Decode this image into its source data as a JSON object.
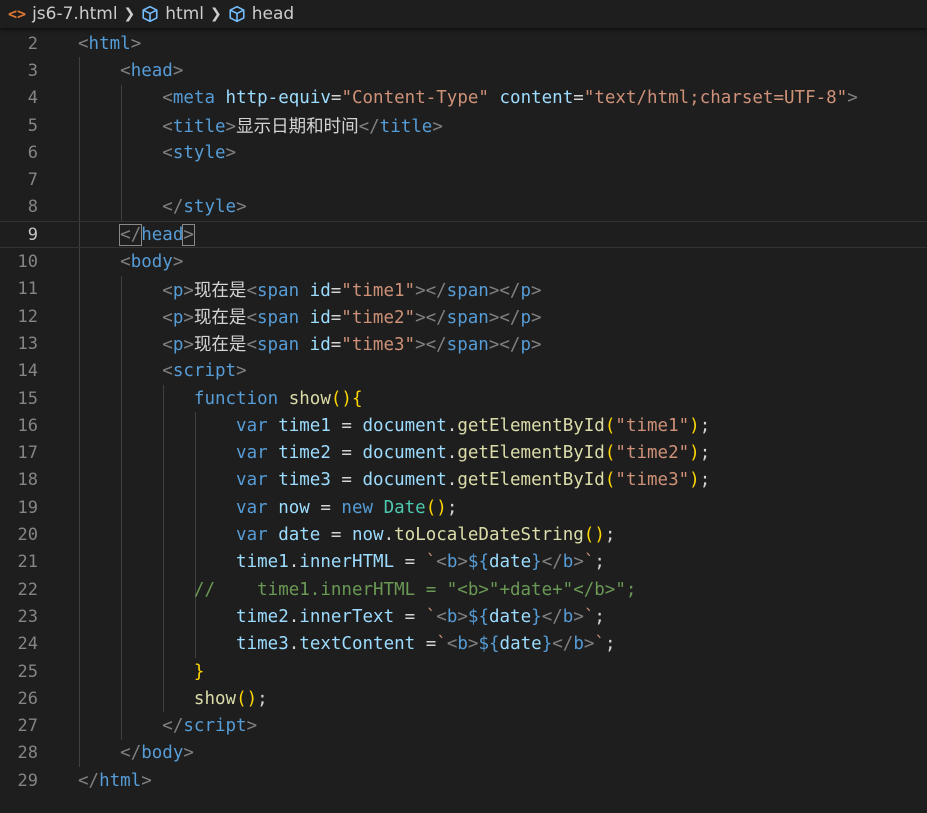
{
  "breadcrumb": {
    "file_icon": "<>",
    "file": "js6-7.html",
    "items": [
      "html",
      "head"
    ]
  },
  "lines": [
    {
      "n": "2",
      "tokens": [
        [
          "p",
          "<"
        ],
        [
          "t",
          "html"
        ],
        [
          "p",
          ">"
        ]
      ]
    },
    {
      "n": "3",
      "tokens": [
        [
          "w",
          "    "
        ],
        [
          "p",
          "<"
        ],
        [
          "t",
          "head"
        ],
        [
          "p",
          ">"
        ]
      ]
    },
    {
      "n": "4",
      "tokens": [
        [
          "w",
          "        "
        ],
        [
          "p",
          "<"
        ],
        [
          "t",
          "meta "
        ],
        [
          "a",
          "http-equiv"
        ],
        [
          "w",
          "="
        ],
        [
          "s",
          "\"Content-Type\""
        ],
        [
          "w",
          " "
        ],
        [
          "a",
          "content"
        ],
        [
          "w",
          "="
        ],
        [
          "s",
          "\"text/html;charset=UTF-8\""
        ],
        [
          "p",
          ">"
        ]
      ]
    },
    {
      "n": "5",
      "tokens": [
        [
          "w",
          "        "
        ],
        [
          "p",
          "<"
        ],
        [
          "t",
          "title"
        ],
        [
          "p",
          ">"
        ],
        [
          "w",
          "显示日期和时间"
        ],
        [
          "p",
          "</"
        ],
        [
          "t",
          "title"
        ],
        [
          "p",
          ">"
        ]
      ]
    },
    {
      "n": "6",
      "tokens": [
        [
          "w",
          "        "
        ],
        [
          "p",
          "<"
        ],
        [
          "t",
          "style"
        ],
        [
          "p",
          ">"
        ]
      ]
    },
    {
      "n": "7",
      "tokens": []
    },
    {
      "n": "8",
      "tokens": [
        [
          "w",
          "        "
        ],
        [
          "p",
          "</"
        ],
        [
          "t",
          "style"
        ],
        [
          "p",
          ">"
        ]
      ]
    },
    {
      "n": "9",
      "tokens": [
        [
          "w",
          "    "
        ],
        [
          "p",
          "</"
        ],
        [
          "t",
          "head"
        ],
        [
          "p",
          ">"
        ]
      ],
      "current": true
    },
    {
      "n": "10",
      "tokens": [
        [
          "w",
          "    "
        ],
        [
          "p",
          "<"
        ],
        [
          "t",
          "body"
        ],
        [
          "p",
          ">"
        ]
      ]
    },
    {
      "n": "11",
      "tokens": [
        [
          "w",
          "        "
        ],
        [
          "p",
          "<"
        ],
        [
          "t",
          "p"
        ],
        [
          "p",
          ">"
        ],
        [
          "w",
          "现在是"
        ],
        [
          "p",
          "<"
        ],
        [
          "t",
          "span "
        ],
        [
          "a",
          "id"
        ],
        [
          "w",
          "="
        ],
        [
          "s",
          "\"time1\""
        ],
        [
          "p",
          "></"
        ],
        [
          "t",
          "span"
        ],
        [
          "p",
          "></"
        ],
        [
          "t",
          "p"
        ],
        [
          "p",
          ">"
        ]
      ]
    },
    {
      "n": "12",
      "tokens": [
        [
          "w",
          "        "
        ],
        [
          "p",
          "<"
        ],
        [
          "t",
          "p"
        ],
        [
          "p",
          ">"
        ],
        [
          "w",
          "现在是"
        ],
        [
          "p",
          "<"
        ],
        [
          "t",
          "span "
        ],
        [
          "a",
          "id"
        ],
        [
          "w",
          "="
        ],
        [
          "s",
          "\"time2\""
        ],
        [
          "p",
          "></"
        ],
        [
          "t",
          "span"
        ],
        [
          "p",
          "></"
        ],
        [
          "t",
          "p"
        ],
        [
          "p",
          ">"
        ]
      ]
    },
    {
      "n": "13",
      "tokens": [
        [
          "w",
          "        "
        ],
        [
          "p",
          "<"
        ],
        [
          "t",
          "p"
        ],
        [
          "p",
          ">"
        ],
        [
          "w",
          "现在是"
        ],
        [
          "p",
          "<"
        ],
        [
          "t",
          "span "
        ],
        [
          "a",
          "id"
        ],
        [
          "w",
          "="
        ],
        [
          "s",
          "\"time3\""
        ],
        [
          "p",
          "></"
        ],
        [
          "t",
          "span"
        ],
        [
          "p",
          "></"
        ],
        [
          "t",
          "p"
        ],
        [
          "p",
          ">"
        ]
      ]
    },
    {
      "n": "14",
      "tokens": [
        [
          "w",
          "        "
        ],
        [
          "p",
          "<"
        ],
        [
          "t",
          "script"
        ],
        [
          "p",
          ">"
        ]
      ]
    },
    {
      "n": "15",
      "tokens": [
        [
          "w",
          "           "
        ],
        [
          "k",
          "function "
        ],
        [
          "f",
          "show"
        ],
        [
          "y",
          "(){"
        ]
      ]
    },
    {
      "n": "16",
      "tokens": [
        [
          "w",
          "               "
        ],
        [
          "k",
          "var "
        ],
        [
          "a",
          "time1"
        ],
        [
          "w",
          " = "
        ],
        [
          "a",
          "document"
        ],
        [
          "w",
          "."
        ],
        [
          "f",
          "getElementById"
        ],
        [
          "y",
          "("
        ],
        [
          "s",
          "\"time1\""
        ],
        [
          "y",
          ")"
        ],
        [
          "w",
          ";"
        ]
      ]
    },
    {
      "n": "17",
      "tokens": [
        [
          "w",
          "               "
        ],
        [
          "k",
          "var "
        ],
        [
          "a",
          "time2"
        ],
        [
          "w",
          " = "
        ],
        [
          "a",
          "document"
        ],
        [
          "w",
          "."
        ],
        [
          "f",
          "getElementById"
        ],
        [
          "y",
          "("
        ],
        [
          "s",
          "\"time2\""
        ],
        [
          "y",
          ")"
        ],
        [
          "w",
          ";"
        ]
      ]
    },
    {
      "n": "18",
      "tokens": [
        [
          "w",
          "               "
        ],
        [
          "k",
          "var "
        ],
        [
          "a",
          "time3"
        ],
        [
          "w",
          " = "
        ],
        [
          "a",
          "document"
        ],
        [
          "w",
          "."
        ],
        [
          "f",
          "getElementById"
        ],
        [
          "y",
          "("
        ],
        [
          "s",
          "\"time3\""
        ],
        [
          "y",
          ")"
        ],
        [
          "w",
          ";"
        ]
      ]
    },
    {
      "n": "19",
      "tokens": [
        [
          "w",
          "               "
        ],
        [
          "k",
          "var "
        ],
        [
          "a",
          "now"
        ],
        [
          "w",
          " = "
        ],
        [
          "k",
          "new "
        ],
        [
          "cls",
          "Date"
        ],
        [
          "y",
          "()"
        ],
        [
          "w",
          ";"
        ]
      ]
    },
    {
      "n": "20",
      "tokens": [
        [
          "w",
          "               "
        ],
        [
          "k",
          "var "
        ],
        [
          "a",
          "date"
        ],
        [
          "w",
          " = "
        ],
        [
          "a",
          "now"
        ],
        [
          "w",
          "."
        ],
        [
          "f",
          "toLocaleDateString"
        ],
        [
          "y",
          "()"
        ],
        [
          "w",
          ";"
        ]
      ]
    },
    {
      "n": "21",
      "tokens": [
        [
          "w",
          "               "
        ],
        [
          "a",
          "time1"
        ],
        [
          "w",
          "."
        ],
        [
          "a",
          "innerHTML"
        ],
        [
          "w",
          " = "
        ],
        [
          "s",
          "`"
        ],
        [
          "p",
          "<"
        ],
        [
          "t",
          "b"
        ],
        [
          "p",
          ">"
        ],
        [
          "k",
          "${"
        ],
        [
          "a",
          "date"
        ],
        [
          "k",
          "}"
        ],
        [
          "p",
          "</"
        ],
        [
          "t",
          "b"
        ],
        [
          "p",
          ">"
        ],
        [
          "s",
          "`"
        ],
        [
          "w",
          ";"
        ]
      ]
    },
    {
      "n": "22",
      "tokens": [
        [
          "w",
          "           "
        ],
        [
          "c",
          "//    time1.innerHTML = \"<b>\"+date+\"</b>\";"
        ]
      ]
    },
    {
      "n": "23",
      "tokens": [
        [
          "w",
          "               "
        ],
        [
          "a",
          "time2"
        ],
        [
          "w",
          "."
        ],
        [
          "a",
          "innerText"
        ],
        [
          "w",
          " = "
        ],
        [
          "s",
          "`"
        ],
        [
          "p",
          "<"
        ],
        [
          "t",
          "b"
        ],
        [
          "p",
          ">"
        ],
        [
          "k",
          "${"
        ],
        [
          "a",
          "date"
        ],
        [
          "k",
          "}"
        ],
        [
          "p",
          "</"
        ],
        [
          "t",
          "b"
        ],
        [
          "p",
          ">"
        ],
        [
          "s",
          "`"
        ],
        [
          "w",
          ";"
        ]
      ]
    },
    {
      "n": "24",
      "tokens": [
        [
          "w",
          "               "
        ],
        [
          "a",
          "time3"
        ],
        [
          "w",
          "."
        ],
        [
          "a",
          "textContent"
        ],
        [
          "w",
          " ="
        ],
        [
          "s",
          "`"
        ],
        [
          "p",
          "<"
        ],
        [
          "t",
          "b"
        ],
        [
          "p",
          ">"
        ],
        [
          "k",
          "${"
        ],
        [
          "a",
          "date"
        ],
        [
          "k",
          "}"
        ],
        [
          "p",
          "</"
        ],
        [
          "t",
          "b"
        ],
        [
          "p",
          ">"
        ],
        [
          "s",
          "`"
        ],
        [
          "w",
          ";"
        ]
      ]
    },
    {
      "n": "25",
      "tokens": [
        [
          "w",
          "           "
        ],
        [
          "y",
          "}"
        ]
      ]
    },
    {
      "n": "26",
      "tokens": [
        [
          "w",
          "           "
        ],
        [
          "f",
          "show"
        ],
        [
          "y",
          "()"
        ],
        [
          "w",
          ";"
        ]
      ]
    },
    {
      "n": "27",
      "tokens": [
        [
          "w",
          "        "
        ],
        [
          "p",
          "</"
        ],
        [
          "t",
          "script"
        ],
        [
          "p",
          ">"
        ]
      ]
    },
    {
      "n": "28",
      "tokens": [
        [
          "w",
          "    "
        ],
        [
          "p",
          "</"
        ],
        [
          "t",
          "body"
        ],
        [
          "p",
          ">"
        ]
      ]
    },
    {
      "n": "29",
      "tokens": [
        [
          "p",
          "</"
        ],
        [
          "t",
          "html"
        ],
        [
          "p",
          ">"
        ]
      ]
    }
  ]
}
